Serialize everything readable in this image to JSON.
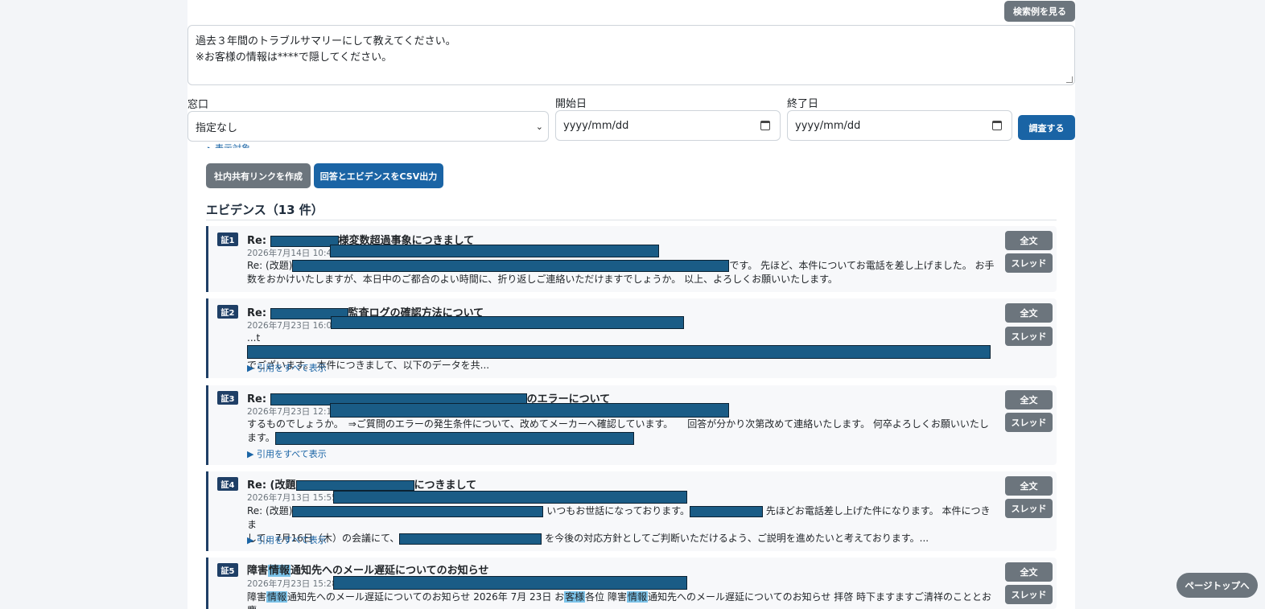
{
  "header": {
    "example_button": "検索例を見る",
    "query_line1": "過去３年間のトラブルサマリーにして教えてください。",
    "query_line2": "※お客様の情報は****で隠してください。"
  },
  "filters": {
    "window_label": "窓口",
    "window_value": "指定なし",
    "start_label": "開始日",
    "start_placeholder": "yyyy/mm/dd",
    "end_label": "終了日",
    "end_placeholder": "yyyy/mm/dd",
    "search_button": "調査する",
    "collapsed_peek": "▸ 表示対象"
  },
  "actions": {
    "share_link_button": "社内共有リンクを作成",
    "csv_export_button": "回答とエビデンスをCSV出力"
  },
  "evidence": {
    "heading": "エビデンス（13 件）",
    "full_text_button": "全文",
    "thread_button": "スレッド",
    "show_quotes": "▶ 引用をすべて表示",
    "items": [
      {
        "badge": "証1",
        "title_prefix": "Re: ",
        "title_suffix": "様変数超過事象につきまして",
        "date": "2026年7月14日 10:40",
        "body_prefix": "Re: (改題)",
        "body_line1_suffix": "です。 先ほど、本件についてお電話を差し上げました。 お手",
        "body_line2": "数をおかけいたしますが、本日中のご都合のよい時間に、折り返しご連絡いただけますでしょうか。 以上、よろしくお願いいたします。"
      },
      {
        "badge": "証2",
        "title_prefix": "Re: ",
        "title_suffix": "監査ログの確認方法について",
        "date": "2026年7月23日 16:06",
        "body_prefix": "...t",
        "body_line2": "でございます。 本件につきまして、以下のデータを共..."
      },
      {
        "badge": "証3",
        "title_prefix": "Re: ",
        "title_suffix": "のエラーについて",
        "date": "2026年7月23日 12:15",
        "body_line1": "するものでしょうか。　⇒ご質問のエラーの発生条件について、改めてメーカーへ確認しています。　　回答が分かり次第改めて連絡いたします。 何卒よろしくお願いいたし",
        "body_line2_prefix": "ます。"
      },
      {
        "badge": "証4",
        "title_prefix": "Re: (改題",
        "title_suffix": "につきまして",
        "date": "2026年7月13日 15:55",
        "body_prefix": "Re: (改題)",
        "body_mid1": " いつもお世話になっております。",
        "body_mid2": " 先ほどお電話差し上げた件になります。 本件につきま",
        "body_line2_prefix": "して、7月16日（木）の会議にて、",
        "body_line2_suffix": " を今後の対応方針としてご判断いただけるよう、ご説明を進めたいと考えております。..."
      },
      {
        "badge": "証5",
        "title_part1": "障害",
        "title_hl": "情報",
        "title_part2": "通知先へのメール遅延についてのお知らせ",
        "date": "2026年7月23日 15:28",
        "body_seg1": "障害",
        "body_hl1": "情報",
        "body_seg2": "通知先へのメール遅延についてのお知らせ 2026年 7月 23日 お",
        "body_hl2": "客様",
        "body_seg3": "各位 障害",
        "body_hl3": "情報",
        "body_seg4": "通知先へのメール遅延についてのお知らせ 拝啓 時下ますますご清祥のこととお慶"
      }
    ]
  },
  "page_top_button": "ページトップへ"
}
